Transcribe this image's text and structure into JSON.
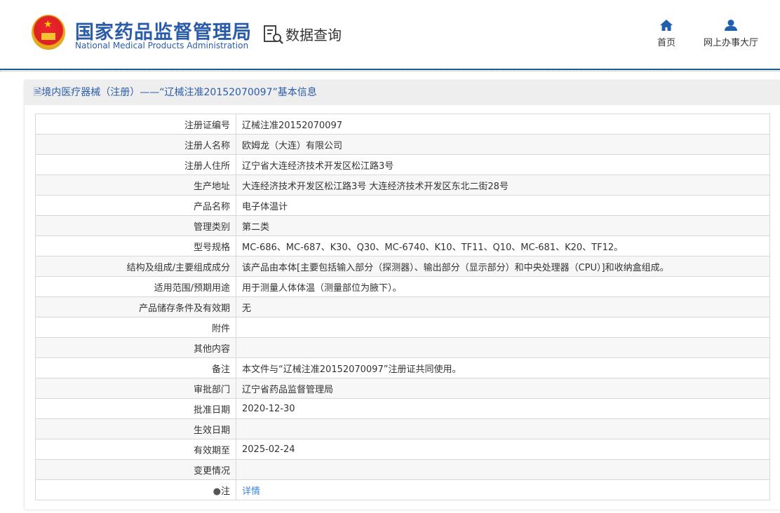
{
  "header": {
    "logo_cn": "国家药品监督管理局",
    "logo_en": "National Medical Products Administration",
    "section": "数据查询",
    "nav": [
      {
        "label": "首页",
        "icon": "home-icon"
      },
      {
        "label": "网上办事大厅",
        "icon": "user-icon"
      }
    ]
  },
  "panel": {
    "title": "境内医疗器械（注册）——“辽械注准20152070097”基本信息"
  },
  "rows": [
    {
      "label": "注册证编号",
      "value": "辽械注准20152070097"
    },
    {
      "label": "注册人名称",
      "value": "欧姆龙（大连）有限公司"
    },
    {
      "label": "注册人住所",
      "value": "辽宁省大连经济技术开发区松江路3号"
    },
    {
      "label": "生产地址",
      "value": "大连经济技术开发区松江路3号 大连经济技术开发区东北二街28号"
    },
    {
      "label": "产品名称",
      "value": "电子体温计"
    },
    {
      "label": "管理类别",
      "value": "第二类"
    },
    {
      "label": "型号规格",
      "value": "MC-686、MC-687、K30、Q30、MC-6740、K10、TF11、Q10、MC-681、K20、TF12。"
    },
    {
      "label": "结构及组成/主要组成成分",
      "value": "该产品由本体[主要包括输入部分（探测器）、输出部分（显示部分）和中央处理器（CPU）]和收纳盒组成。"
    },
    {
      "label": "适用范围/预期用途",
      "value": "用于测量人体体温（测量部位为腋下）。"
    },
    {
      "label": "产品储存条件及有效期",
      "value": "无"
    },
    {
      "label": "附件",
      "value": ""
    },
    {
      "label": "其他内容",
      "value": ""
    },
    {
      "label": "备注",
      "value": "本文件与“辽械注准20152070097”注册证共同使用。"
    },
    {
      "label": "审批部门",
      "value": "辽宁省药品监督管理局"
    },
    {
      "label": "批准日期",
      "value": "2020-12-30"
    },
    {
      "label": "生效日期",
      "value": ""
    },
    {
      "label": "有效期至",
      "value": "2025-02-24"
    },
    {
      "label": "变更情况",
      "value": ""
    }
  ],
  "note": {
    "label": "注",
    "link": "详情"
  }
}
